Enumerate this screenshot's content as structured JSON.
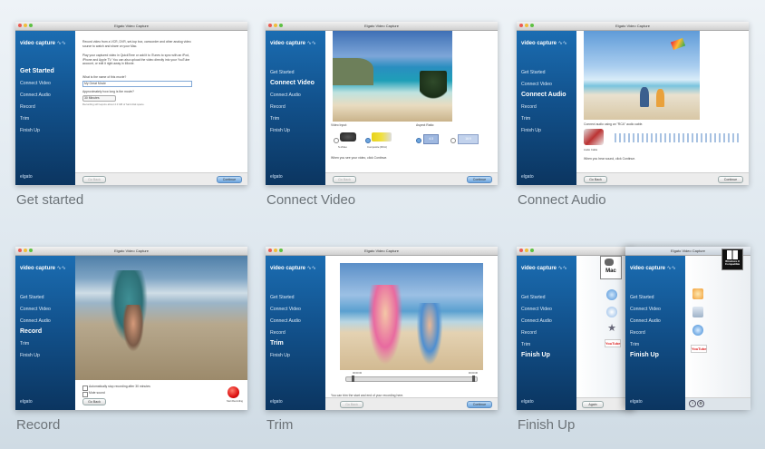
{
  "window_title": "Elgato Video Capture",
  "logo": {
    "text": "video capture",
    "brand": "elgato"
  },
  "steps": [
    "Get Started",
    "Connect Video",
    "Connect Audio",
    "Record",
    "Trim",
    "Finish Up"
  ],
  "captions": [
    "Get started",
    "Connect Video",
    "Connect Audio",
    "Record",
    "Trim",
    "Finish Up"
  ],
  "buttons": {
    "go_back": "Go Back",
    "continue": "Continue",
    "again": "Again",
    "start_recording": "Start Recording"
  },
  "get_started": {
    "intro": "Record video from a VCR, DVR, set-top box, camcorder and other analog video source to watch and share on your Mac.",
    "intro2": "Play your captured video in QuickTime or add it to iTunes to sync with an iPod, iPhone and Apple TV. You can also upload the video directly into your YouTube account, or edit it right away in iMovie.",
    "name_label": "What is the name of this movie?",
    "name_value": "My Great Movie",
    "length_label": "Approximately how long is the movie?",
    "length_value": "30 Minutes",
    "space_note": "Recording will require about 2.0 GB of hard disk space."
  },
  "connect_video": {
    "video_input_label": "Video Input:",
    "aspect_ratio_label": "Aspect Ratio:",
    "svideo": "S-Video",
    "composite": "Composite (RCA)",
    "ratio_43": "4:3",
    "ratio_169": "16:9",
    "hint": "When you see your video, click Continue."
  },
  "connect_audio": {
    "hint_top": "Connect audio using an \"RCA\" audio cable.",
    "cable": "Audio Cable",
    "hint": "When you hear sound, click Continue."
  },
  "record": {
    "auto_stop": "Automatically stop recording after 30 minutes",
    "mute": "Mute sound"
  },
  "trim": {
    "hint": "You can trim the start and end of your recording here.",
    "time_start": "00:00:00",
    "time_end": "00:00:30"
  },
  "finish": {
    "mac_badge": "Mac",
    "youtube": "YouTube",
    "windows_line1": "Windows 8",
    "windows_line2": "Compatible"
  },
  "colors": {
    "sidebar": "#12528d",
    "accent": "#6ea6de",
    "caption": "#6c7378"
  }
}
